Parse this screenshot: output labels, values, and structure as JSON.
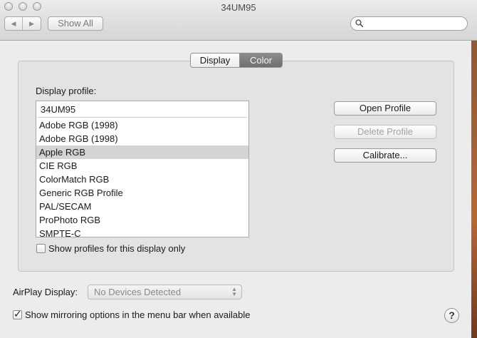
{
  "window": {
    "title": "34UM95"
  },
  "toolbar": {
    "back_icon": "◀",
    "forward_icon": "▶",
    "show_all_label": "Show All",
    "search": {
      "value": "",
      "placeholder": ""
    }
  },
  "tabs": [
    {
      "label": "Display",
      "selected": false
    },
    {
      "label": "Color",
      "selected": true
    }
  ],
  "color_pane": {
    "profile_label": "Display profile:",
    "current_profile": "34UM95",
    "profiles": [
      {
        "label": "Adobe RGB (1998)",
        "selected": false
      },
      {
        "label": "Adobe RGB (1998)",
        "selected": false
      },
      {
        "label": "Apple RGB",
        "selected": true
      },
      {
        "label": "CIE RGB",
        "selected": false
      },
      {
        "label": "ColorMatch RGB",
        "selected": false
      },
      {
        "label": "Generic RGB Profile",
        "selected": false
      },
      {
        "label": "PAL/SECAM",
        "selected": false
      },
      {
        "label": "ProPhoto RGB",
        "selected": false
      },
      {
        "label": "SMPTE-C",
        "selected": false
      }
    ],
    "show_profiles_only": {
      "label": "Show profiles for this display only",
      "checked": false
    },
    "buttons": {
      "open_profile": "Open Profile",
      "delete_profile": "Delete Profile",
      "calibrate": "Calibrate..."
    }
  },
  "airplay": {
    "label": "AirPlay Display:",
    "value": "No Devices Detected"
  },
  "mirroring": {
    "label": "Show mirroring options in the menu bar when available",
    "checked": true
  },
  "help_label": "?",
  "colors": {
    "selected_tab": "#7d7d7d",
    "selected_row": "#d4d4d4",
    "panel": "#e3e3e3"
  }
}
